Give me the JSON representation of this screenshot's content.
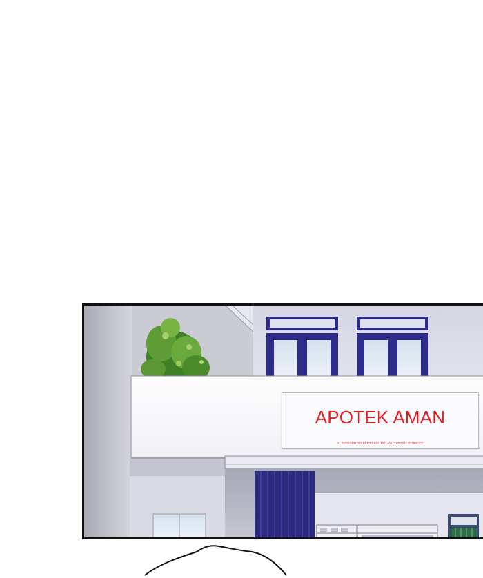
{
  "scene": {
    "storefront": {
      "sign": {
        "name": "APOTEK AMAN",
        "address": "JL.ANDSABD NO.14 RT.2 KEL.MELAYU TLP.0041 47488CCC"
      }
    }
  },
  "colors": {
    "sign_text": "#e01e24",
    "window_frame": "#2c2b8a",
    "curtain": "#2c2b7e",
    "tree": "#4e8f2c",
    "panel_border": "#111111"
  }
}
